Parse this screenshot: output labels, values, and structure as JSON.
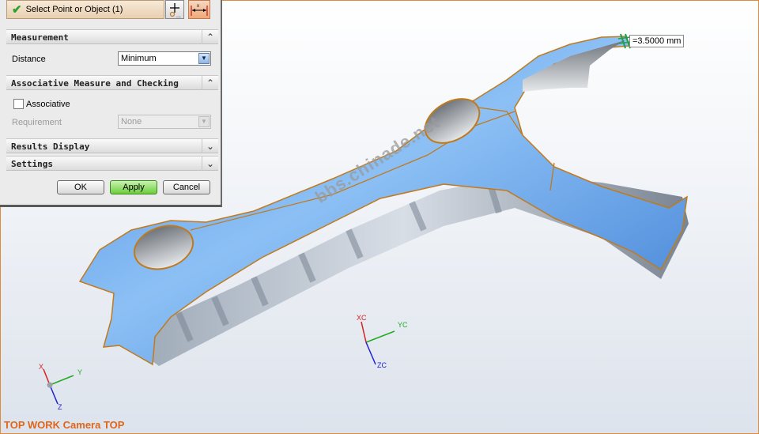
{
  "dialog": {
    "selection": {
      "label": "Select Point or Object (1)",
      "icon": "check-icon"
    },
    "sections": {
      "measurement": "Measurement",
      "associative": "Associative Measure and Checking",
      "results": "Results Display",
      "settings": "Settings"
    },
    "distance": {
      "label": "Distance",
      "value": "Minimum"
    },
    "associative_checkbox": {
      "label": "Associative",
      "checked": false
    },
    "requirement": {
      "label": "Requirement",
      "value": "None"
    },
    "buttons": {
      "ok": "OK",
      "apply": "Apply",
      "cancel": "Cancel"
    }
  },
  "viewport": {
    "measurement_value": "=3.5000 mm",
    "watermark": "bbs.chinade.net",
    "view_label": "TOP WORK Camera TOP",
    "work_csys": {
      "x": "XC",
      "y": "YC",
      "z": "ZC"
    },
    "abs_csys": {
      "x": "X",
      "y": "Y",
      "z": "Z"
    }
  },
  "colors": {
    "part": "#5b9ee8",
    "edge": "#c07a1e",
    "accent": "#e0651c"
  }
}
